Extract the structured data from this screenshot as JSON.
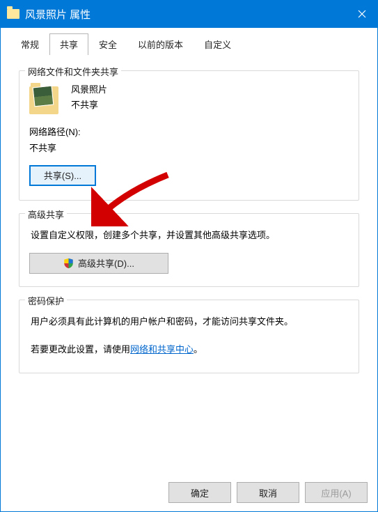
{
  "titlebar": {
    "title": "风景照片 属性"
  },
  "tabs": {
    "general": "常规",
    "sharing": "共享",
    "security": "安全",
    "previous": "以前的版本",
    "custom": "自定义"
  },
  "group_network": {
    "legend": "网络文件和文件夹共享",
    "item_name": "风景照片",
    "item_status": "不共享",
    "path_label": "网络路径(N):",
    "path_value": "不共享",
    "share_button": "共享(S)..."
  },
  "group_advanced": {
    "legend": "高级共享",
    "desc": "设置自定义权限，创建多个共享，并设置其他高级共享选项。",
    "button": "高级共享(D)..."
  },
  "group_password": {
    "legend": "密码保护",
    "line1": "用户必须具有此计算机的用户帐户和密码，才能访问共享文件夹。",
    "line2_prefix": "若要更改此设置，请使用",
    "line2_link": "网络和共享中心",
    "line2_suffix": "。"
  },
  "buttons": {
    "ok": "确定",
    "cancel": "取消",
    "apply": "应用(A)"
  }
}
